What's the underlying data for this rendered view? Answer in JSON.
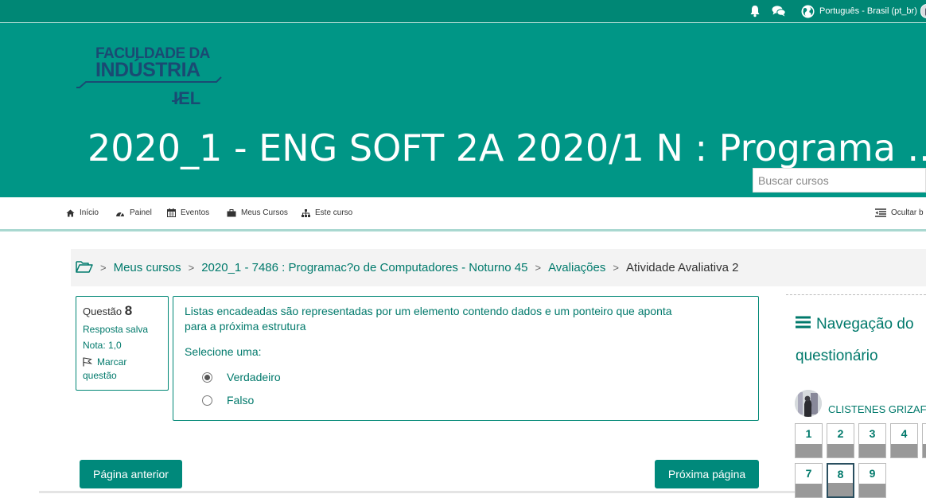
{
  "topbar": {
    "language_label": "Português - Brasil (pt_br)",
    "icons": [
      "bell-icon",
      "chat-icon",
      "globe-icon",
      "user-avatar"
    ]
  },
  "header": {
    "logo": {
      "line1": "FACULDADE DA",
      "line2": "INDÚSTRIA",
      "line3": "IEL"
    },
    "course_title": "2020_1 - ENG SOFT 2A 2020/1 N : Programa ...",
    "search_placeholder": "Buscar cursos"
  },
  "navbar": {
    "items": [
      {
        "label": "Início",
        "icon": "home-icon"
      },
      {
        "label": "Painel",
        "icon": "dashboard-icon"
      },
      {
        "label": "Eventos",
        "icon": "calendar-icon"
      },
      {
        "label": "Meus Cursos",
        "icon": "briefcase-icon"
      },
      {
        "label": "Este curso",
        "icon": "sitemap-icon"
      }
    ],
    "right_label": "Ocultar b"
  },
  "breadcrumb": {
    "items": [
      "Meus cursos",
      "2020_1 - 7486 : Programac?o de Computadores - Noturno 45",
      "Avaliações",
      "Atividade Avaliativa 2"
    ]
  },
  "question_info": {
    "label": "Questão",
    "number": "8",
    "status": "Resposta salva",
    "grade": "Nota: 1,0",
    "flag_line1": "Marcar",
    "flag_line2": "questão"
  },
  "question": {
    "text_line1": "Listas encadeadas são representadas por um elemento contendo dados e um ponteiro que aponta",
    "text_line2": "para a próxima estrutura",
    "prompt": "Selecione uma:",
    "options": [
      {
        "label": "Verdadeiro",
        "selected": true
      },
      {
        "label": "Falso",
        "selected": false
      }
    ]
  },
  "buttons": {
    "prev": "Página anterior",
    "next": "Próxima página"
  },
  "sidebar": {
    "title_line1": "Navegação do",
    "title_line2": "questionário",
    "username": "CLISTENES GRIZAF",
    "questions": [
      "1",
      "2",
      "3",
      "4",
      "",
      "7",
      "8",
      "9"
    ],
    "current": "8"
  },
  "colors": {
    "header": "#009686",
    "topbar": "#008775",
    "accent_text": "#00796b",
    "button": "#00897b"
  }
}
